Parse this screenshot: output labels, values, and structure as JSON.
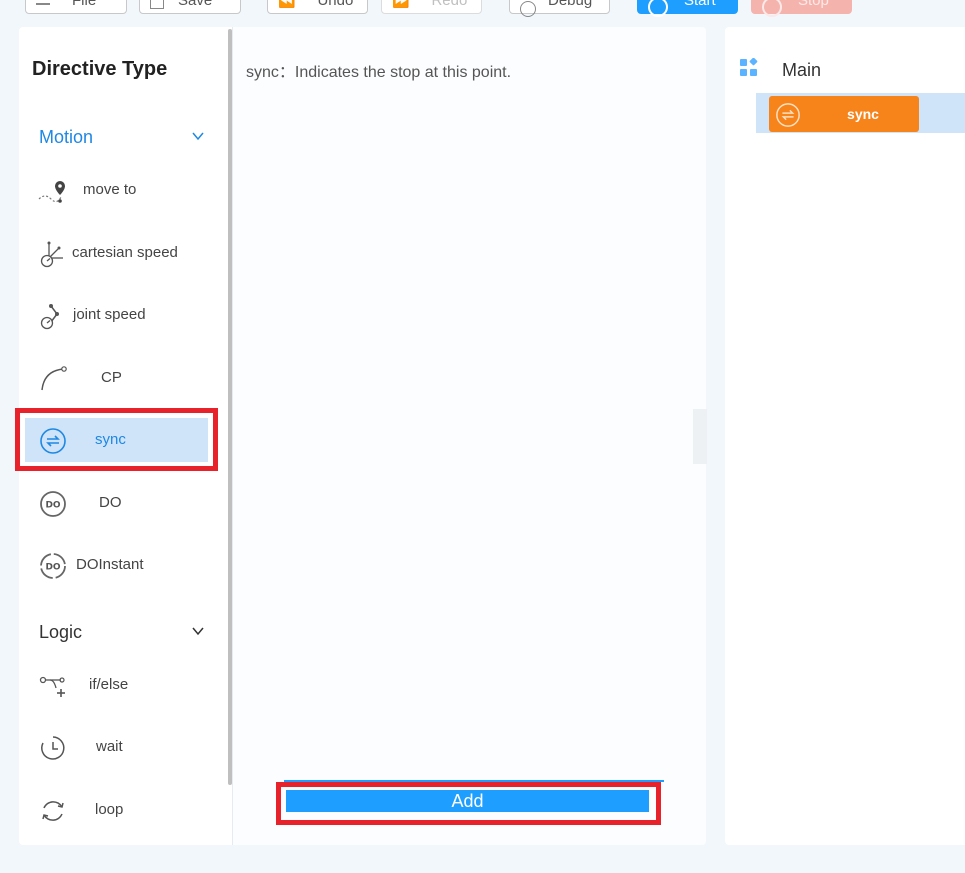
{
  "toolbar": {
    "file_label": "File",
    "save_label": "Save",
    "undo_label": "Undo",
    "redo_label": "Redo",
    "debug_label": "Debug",
    "start_label": "Start",
    "stop_label": "Stop"
  },
  "left": {
    "title": "Directive Type",
    "groups": [
      {
        "label": "Motion",
        "items": [
          {
            "label": "move to",
            "icon": "waypoint-icon"
          },
          {
            "label": "cartesian speed",
            "icon": "cartesian-speed-icon"
          },
          {
            "label": "joint speed",
            "icon": "joint-speed-icon"
          },
          {
            "label": "CP",
            "icon": "curve-icon"
          },
          {
            "label": "sync",
            "icon": "sync-icon"
          },
          {
            "label": "DO",
            "icon": "do-icon"
          },
          {
            "label": "DOInstant",
            "icon": "do-instant-icon"
          }
        ]
      },
      {
        "label": "Logic",
        "items": [
          {
            "label": "if/else",
            "icon": "branch-icon"
          },
          {
            "label": "wait",
            "icon": "clock-icon"
          },
          {
            "label": "loop",
            "icon": "loop-icon"
          }
        ]
      }
    ]
  },
  "middle": {
    "description": "sync：Indicates the stop at this point.",
    "add_label": "Add"
  },
  "right": {
    "root_label": "Main",
    "block_label": "sync"
  },
  "colors": {
    "accent": "#1e9fff",
    "selected_bg": "#cfe4f8",
    "sync_block": "#f7831b",
    "highlight": "#e8222b"
  }
}
